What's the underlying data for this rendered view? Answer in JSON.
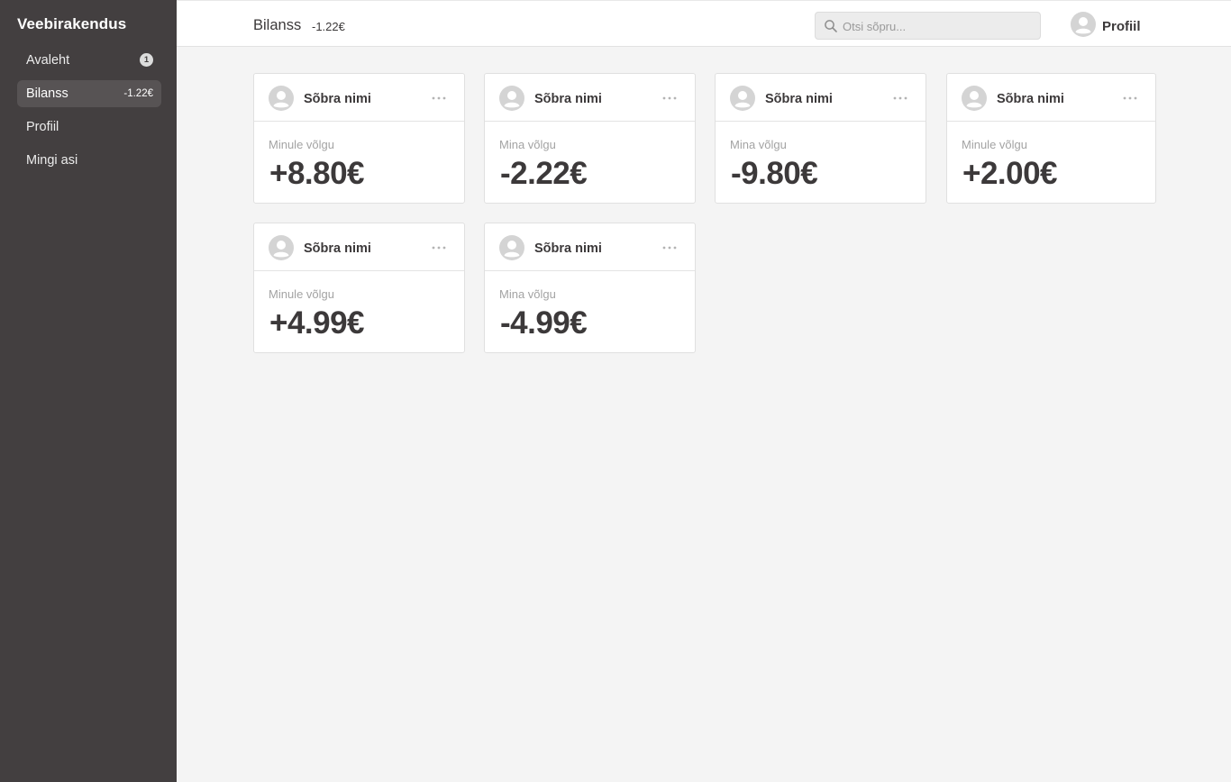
{
  "app": {
    "title": "Veebirakendus"
  },
  "sidebar": {
    "items": [
      {
        "label": "Avaleht",
        "badge": "1"
      },
      {
        "label": "Bilanss",
        "amount": "-1.22€"
      },
      {
        "label": "Profiil"
      },
      {
        "label": "Mingi asi"
      }
    ],
    "active": "Bilanss"
  },
  "header": {
    "title": "Bilanss",
    "balance": "-1.22€",
    "search": {
      "placeholder": "Otsi sõpru...",
      "value": ""
    },
    "profile_label": "Profiil"
  },
  "cards": [
    {
      "name": "Sõbra nimi",
      "label": "Minule võlgu",
      "amount": "+8.80€"
    },
    {
      "name": "Sõbra nimi",
      "label": "Mina võlgu",
      "amount": "-2.22€"
    },
    {
      "name": "Sõbra nimi",
      "label": "Mina võlgu",
      "amount": "-9.80€"
    },
    {
      "name": "Sõbra nimi",
      "label": "Minule võlgu",
      "amount": "+2.00€"
    },
    {
      "name": "Sõbra nimi",
      "label": "Minule võlgu",
      "amount": "+4.99€"
    },
    {
      "name": "Sõbra nimi",
      "label": "Mina võlgu",
      "amount": "-4.99€"
    }
  ],
  "icons": {
    "avatar": "user-avatar-icon",
    "search": "search-icon",
    "more": "more-horizontal-icon"
  },
  "colors": {
    "sidebar_bg": "#433f40",
    "sidebar_active": "#575354",
    "page_bg": "#f4f4f4",
    "text": "#3c393a",
    "muted": "#a3a3a3"
  }
}
